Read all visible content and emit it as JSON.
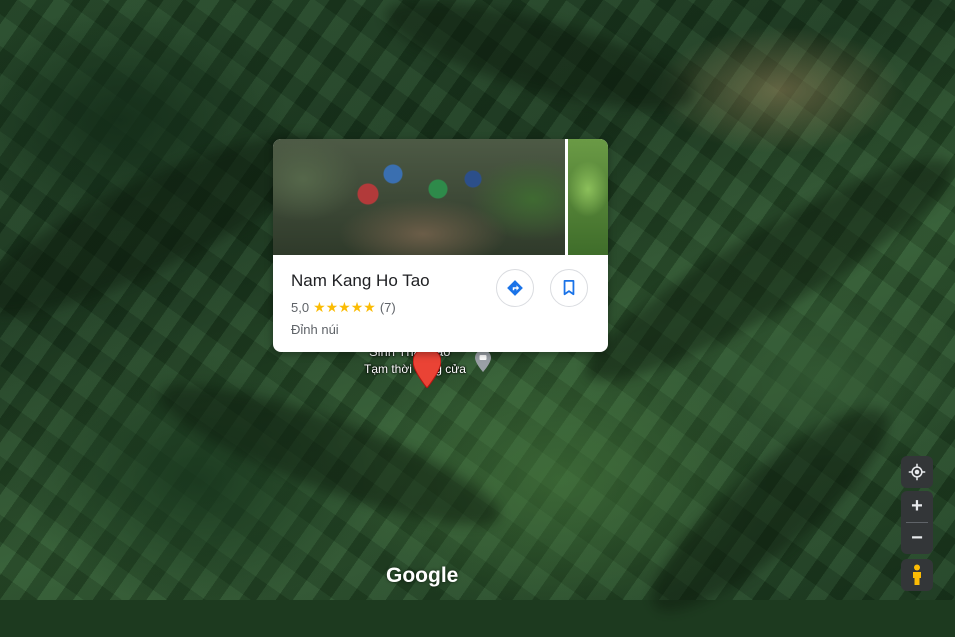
{
  "map": {
    "place_label": "Sinh Thái Pao",
    "place_status": "Tạm thời đóng cửa",
    "logo_text": "Google"
  },
  "card": {
    "name": "Nam Kang Ho Tao",
    "rating": "5,0",
    "stars": "★★★★★",
    "review_count": "(7)",
    "category": "Đỉnh núi",
    "directions_icon": "directions-icon",
    "save_icon": "bookmark-icon"
  },
  "controls": {
    "zoom_in": "+",
    "zoom_out": "−",
    "location_icon": "my-location-icon",
    "pegman_icon": "pegman-icon"
  },
  "colors": {
    "pin": "#ea4335",
    "directions": "#1a73e8",
    "star": "#fbbc04"
  }
}
